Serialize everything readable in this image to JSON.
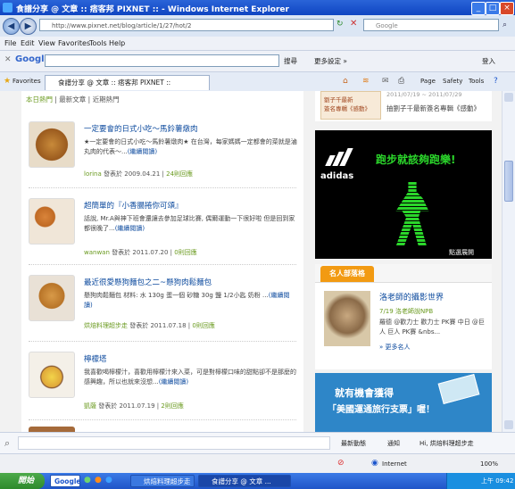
{
  "window": {
    "title": "食譜分享 @ 文章 :: 痞客邦 PIXNET :: - Windows Internet Explorer"
  },
  "address": {
    "url": "http://www.pixnet.net/blog/article/1/27/hot/2",
    "search_placeholder": "Google"
  },
  "menu": [
    "File",
    "Edit",
    "View",
    "Favorites",
    "Tools",
    "Help"
  ],
  "google_toolbar": {
    "label": "Google",
    "search_btn": "搜尋",
    "more": "更多設定 »",
    "signin": "登入"
  },
  "tabbar": {
    "favorites": "Favorites",
    "tab_title": "食譜分享 @ 文章 :: 痞客邦 PIXNET ::",
    "page_menu": "Page",
    "safety_menu": "Safety",
    "tools_menu": "Tools"
  },
  "page": {
    "tabs": [
      "本日熱門",
      "最新文章",
      "近期熱門"
    ],
    "posts": [
      {
        "title": "一定要會的日式小吃～馬鈴薯燉肉",
        "desc": "★一定要會的日式小吃～馬鈴薯燉肉★ 在台灣，每家媽媽一定都會的菜就是滷丸肉的代表～...",
        "more": "(繼續閱讀)",
        "author": "lorina",
        "date": "發表於 2009.04.21",
        "comments": "24則回應"
      },
      {
        "title": "超簡單的『小香腸捲你可頌』",
        "desc": "話說, Mr.A與神下班會還讓去參加足球比賽, 偶爾運動一下很好啦 但是回到家都很晚了...",
        "more": "(繼續閱讀)",
        "author": "wanwan",
        "date": "發表於 2011.07.20",
        "comments": "0則回應"
      },
      {
        "title": "最近很愛懸狗麵包之二~懸狗肉鬆麵包",
        "desc": "懸狗肉鬆麵包 材料: 水 130g 蛋一個 砂糖 30g 鹽 1/2小匙 奶粉 ...",
        "more": "(繼續閱讀)",
        "author": "烘焙料理超步走",
        "date": "發表於 2011.07.18",
        "comments": "0則回應"
      },
      {
        "title": "檸檬塔",
        "desc": "我喜歡喝檸檬汁，喜歡用檸檬汁來入菜，可是對檸檬口味的甜點卻不是那麼的感興趣，所以也就來沒想...",
        "more": "(繼續閱讀)",
        "author": "凱薩",
        "date": "發表於 2011.07.19",
        "comments": "2則回應"
      }
    ],
    "right": {
      "promo_tag": "劉子千最新",
      "promo_tag2": "簽名專輯《感動》",
      "promo_date": "2011/07/19 ~ 2011/07/29",
      "promo_text": "抽劉子千最新簽名專輯《感動》",
      "ad1_brand": "adidas",
      "ad1_slogan": "跑步就該夠跑樂!",
      "ad1_more": "點選展開",
      "mingren_title": "名人部落格",
      "mingren_name": "洛老師的攝影世界",
      "mingren_date": "7/19 洛老師說NPB",
      "mingren_desc": "羅德 @歡力士 歡力士 PK賽 中日 @巨人 巨人 PK賽 &nbs...",
      "mingren_more": "» 更多名人",
      "ad2_line1": "就有機會獲得",
      "ad2_line2": "「美國運通旅行支票」喔！"
    }
  },
  "findbar": {
    "latest": "最新動態",
    "notify": "通知",
    "greeting": "Hi, 烘焙料理超步走"
  },
  "statusbar": {
    "zone": "Internet",
    "zoom": "100%"
  },
  "taskbar": {
    "start": "開始",
    "items": [
      "Google",
      "烘焙料理超步走",
      "食譜分享 @ 文章 ..."
    ],
    "clock": "上午 09:42"
  },
  "colors": {
    "title_blue": "#1a54cc",
    "link_blue": "#0c4a9e",
    "author_green": "#6a9a1f",
    "orange": "#f29a12",
    "adidas_green": "#2bd62b"
  }
}
